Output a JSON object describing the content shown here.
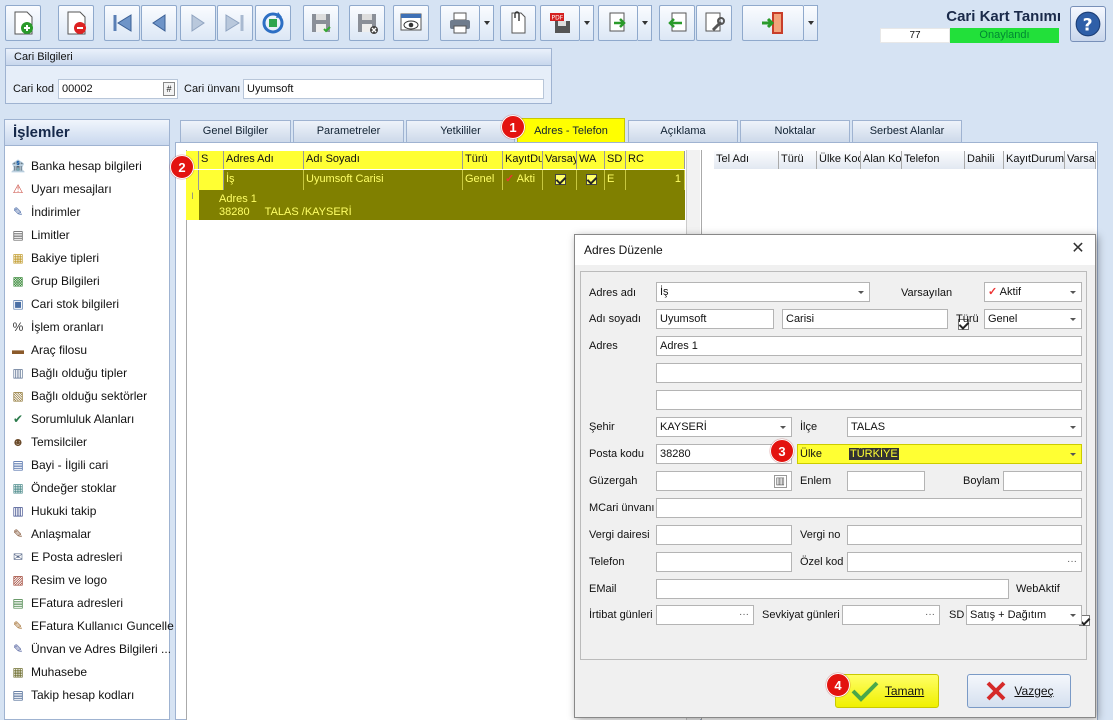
{
  "header": {
    "form_title": "Cari Kart Tanımı",
    "status_number": "77",
    "status_text": "Onaylandı"
  },
  "toolbar": {
    "icons": [
      "add-icon",
      "delete-icon",
      "first-record-icon",
      "previous-record-icon",
      "next-record-icon",
      "last-record-icon",
      "refresh-icon",
      "save-icon",
      "save-close-icon",
      "cancel-save-icon",
      "preview-icon",
      "print-icon",
      "attachment-icon",
      "pdf-icon",
      "export-icon",
      "import-icon",
      "tools-icon",
      "exit-icon"
    ]
  },
  "cari_panel": {
    "title": "Cari Bilgileri",
    "code_label": "Cari kod",
    "code_value": "00002",
    "name_label": "Cari ünvanı",
    "name_value": "Uyumsoft"
  },
  "sidebar": {
    "title": "İşlemler",
    "items": [
      {
        "label": "Banka hesap bilgileri",
        "icon": "bank-icon"
      },
      {
        "label": "Uyarı mesajları",
        "icon": "warning-icon"
      },
      {
        "label": "İndirimler",
        "icon": "discount-icon"
      },
      {
        "label": "Limitler",
        "icon": "limit-icon"
      },
      {
        "label": "Bakiye tipleri",
        "icon": "balance-icon"
      },
      {
        "label": "Grup Bilgileri",
        "icon": "group-icon"
      },
      {
        "label": "Cari stok bilgileri",
        "icon": "stock-icon"
      },
      {
        "label": "İşlem oranları",
        "icon": "percent-icon"
      },
      {
        "label": "Araç filosu",
        "icon": "vehicle-icon"
      },
      {
        "label": "Bağlı olduğu tipler",
        "icon": "type-icon"
      },
      {
        "label": "Bağlı olduğu sektörler",
        "icon": "sector-icon"
      },
      {
        "label": "Sorumluluk Alanları",
        "icon": "responsibility-icon"
      },
      {
        "label": "Temsilciler",
        "icon": "representative-icon"
      },
      {
        "label": "Bayi - İlgili cari",
        "icon": "dealer-icon"
      },
      {
        "label": "Öndeğer stoklar",
        "icon": "default-stock-icon"
      },
      {
        "label": "Hukuki takip",
        "icon": "legal-icon"
      },
      {
        "label": "Anlaşmalar",
        "icon": "agreement-icon"
      },
      {
        "label": "E Posta adresleri",
        "icon": "email-icon"
      },
      {
        "label": "Resim ve logo",
        "icon": "image-icon"
      },
      {
        "label": "EFatura adresleri",
        "icon": "einvoice-icon"
      },
      {
        "label": "EFatura Kullanıcı Guncelle",
        "icon": "einvoice-user-icon"
      },
      {
        "label": "Ünvan ve Adres Bilgileri ...",
        "icon": "address-info-icon"
      },
      {
        "label": "Muhasebe",
        "icon": "accounting-icon"
      },
      {
        "label": "Takip hesap kodları",
        "icon": "tracking-icon"
      }
    ]
  },
  "tabs": [
    {
      "label": "Genel Bilgiler"
    },
    {
      "label": "Parametreler"
    },
    {
      "label": "Yetkililer"
    },
    {
      "label": "Adres - Telefon",
      "active": true
    },
    {
      "label": "Açıklama"
    },
    {
      "label": "Noktalar"
    },
    {
      "label": "Serbest Alanlar"
    }
  ],
  "address_grid": {
    "columns": [
      "S",
      "Adres Adı",
      "Adı Soyadı",
      "Türü",
      "KayıtDu",
      "Varsay",
      "WA",
      "SD",
      "RC"
    ],
    "row": {
      "adres_adi": "İş",
      "adi_soyadi": "Uyumsoft Carisi",
      "turu": "Genel",
      "kayit_durumu": "Akti",
      "sd": "E",
      "rc": "1"
    },
    "detail_line1": "Adres 1",
    "detail_line2": "38280     TALAS /KAYSERİ"
  },
  "phone_grid": {
    "columns": [
      "Tel Adı",
      "Türü",
      "Ülke Koc",
      "Alan Ko",
      "Telefon",
      "Dahili",
      "KayıtDurumu",
      "Varsa"
    ]
  },
  "dialog": {
    "title": "Adres Düzenle",
    "close_glyph": "✕",
    "labels": {
      "adres_adi": "Adres adı",
      "varsayilan": "Varsayılan",
      "adi_soyadi": "Adı soyadı",
      "turu": "Türü",
      "adres": "Adres",
      "sehir": "Şehir",
      "ilce": "İlçe",
      "posta_kodu": "Posta kodu",
      "ulke": "Ülke",
      "guzergah": "Güzergah",
      "enlem": "Enlem",
      "boylam": "Boylam",
      "mcari_unvani": "MCari ünvanı",
      "vergi_dairesi": "Vergi dairesi",
      "vergi_no": "Vergi no",
      "telefon": "Telefon",
      "ozel_kod": "Özel kod",
      "email": "EMail",
      "webaktif": "WebAktif",
      "irtibat_gunleri": "İrtibat günleri",
      "sevkiyat_gunleri": "Sevkiyat günleri",
      "sd": "SD"
    },
    "values": {
      "adres_adi": "İş",
      "status": "Aktif",
      "ad": "Uyumsoft",
      "soyad": "Carisi",
      "turu": "Genel",
      "adres1": "Adres 1",
      "adres2": "",
      "adres3": "",
      "sehir": "KAYSERİ",
      "ilce": "TALAS",
      "posta_kodu": "38280",
      "ulke": "TÜRKİYE",
      "sd": "Satış + Dağıtım"
    },
    "ok_label": "Tamam",
    "cancel_label": "Vazgeç"
  },
  "badges": [
    "1",
    "2",
    "3",
    "4"
  ]
}
